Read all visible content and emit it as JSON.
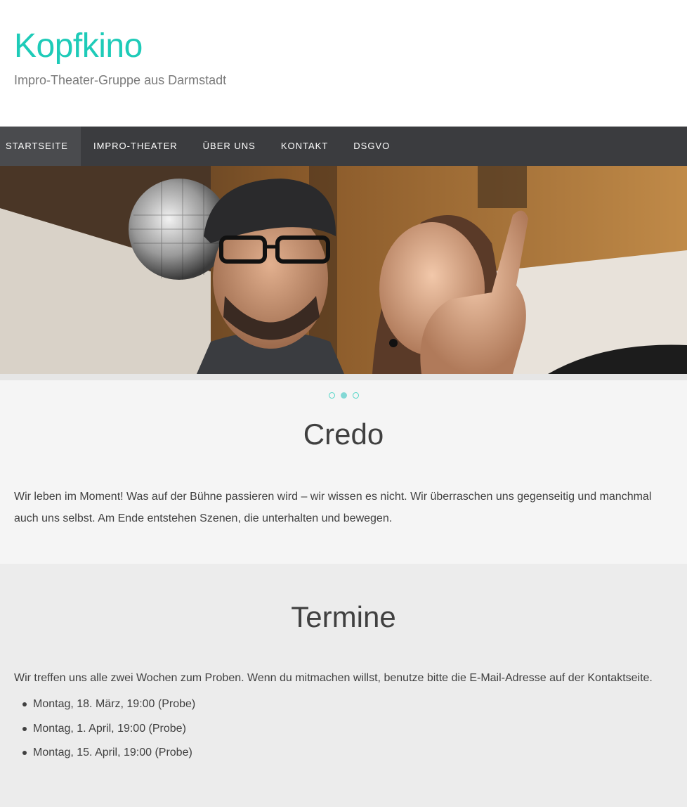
{
  "header": {
    "site_title": "Kopfkino",
    "site_description": "Impro-Theater-Gruppe aus Darmstadt"
  },
  "nav": {
    "items": [
      {
        "label": "STARTSEITE",
        "active": true
      },
      {
        "label": "IMPRO-THEATER"
      },
      {
        "label": "ÜBER UNS"
      },
      {
        "label": "KONTAKT"
      },
      {
        "label": "DSGVO"
      }
    ]
  },
  "slider": {
    "slide_count": 3,
    "active_slide": 2
  },
  "credo": {
    "title": "Credo",
    "text": "Wir leben im Moment! Was auf der Bühne passieren wird – wir wissen es nicht. Wir überraschen uns gegenseitig und manchmal auch uns selbst. Am Ende entstehen Szenen, die unterhalten und bewegen."
  },
  "termine": {
    "title": "Termine",
    "intro": "Wir treffen uns alle zwei Wochen zum Proben. Wenn du mitmachen willst, benutze bitte die E-Mail-Adresse auf der Kontaktseite.",
    "items": [
      "Montag, 18. März, 19:00 (Probe)",
      "Montag, 1. April, 19:00 (Probe)",
      "Montag, 15. April, 19:00 (Probe)"
    ]
  },
  "colors": {
    "accent": "#1ecbb8",
    "nav_bg": "#3b3c3f",
    "nav_active_bg": "#4a4b4e",
    "credo_bg": "#f5f5f5",
    "termine_bg": "#ececec"
  }
}
